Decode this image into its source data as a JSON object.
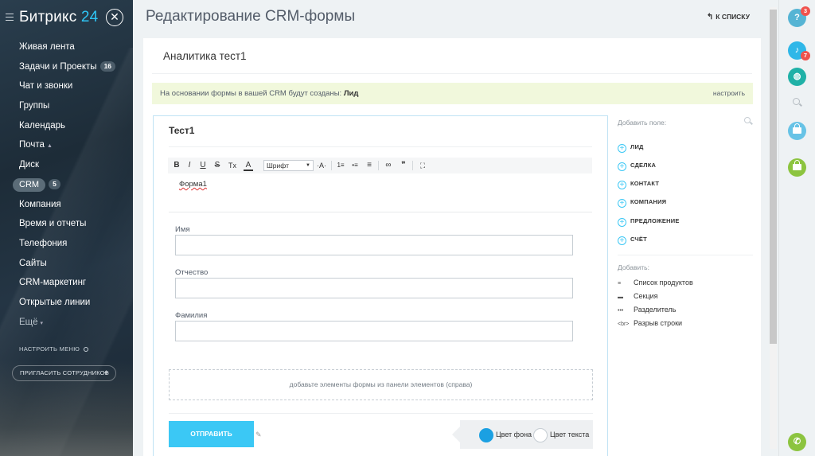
{
  "sidebar": {
    "logo_text": "Битрикс",
    "logo_num": "24",
    "close_glyph": "✕",
    "items": [
      {
        "label": "Живая лента"
      },
      {
        "label": "Задачи и Проекты",
        "badge": "16"
      },
      {
        "label": "Чат и звонки"
      },
      {
        "label": "Группы"
      },
      {
        "label": "Календарь"
      },
      {
        "label": "Почта",
        "arrow": "▲"
      },
      {
        "label": "Диск"
      },
      {
        "label": "CRM",
        "badge": "5"
      },
      {
        "label": "Компания"
      },
      {
        "label": "Время и отчеты"
      },
      {
        "label": "Телефония"
      },
      {
        "label": "Сайты"
      },
      {
        "label": "CRM-маркетинг"
      },
      {
        "label": "Открытые линии"
      },
      {
        "label": "Ещё",
        "arrow": "▾"
      }
    ],
    "settings_menu": "Настроить меню",
    "invite": "Пригласить сотрудников",
    "invite_plus": "+"
  },
  "header": {
    "title": "Редактирование CRM-формы",
    "back_label": "к списку",
    "back_icon": "↰"
  },
  "card": {
    "form_name": "Аналитика тест1",
    "notice_text": "На основании формы в вашей CRM будут созданы: ",
    "notice_entity": "Лид",
    "notice_action": "настроить"
  },
  "editor": {
    "title": "Тест1",
    "toolbar": {
      "bold": "B",
      "italic": "I",
      "underline": "U",
      "strike": "S",
      "clear": "Tx",
      "color": "A",
      "font_select": "Шрифт",
      "font_size": "·A·",
      "ol": "1≡",
      "ul": "•≡",
      "align": "≡",
      "link": "∞",
      "quote": "❞",
      "fullscreen": "⛶"
    },
    "content": "Форма1",
    "fields": [
      {
        "label": "Имя",
        "value": ""
      },
      {
        "label": "Отчество",
        "value": ""
      },
      {
        "label": "Фамилия",
        "value": ""
      }
    ],
    "drop_zone": "добавьте элементы формы из панели элементов (справа)",
    "submit": "Отправить",
    "bg_color_label": "Цвет фона",
    "text_color_label": "Цвет текста",
    "bg_color": "#1ba0e2"
  },
  "right_panel": {
    "add_field_placeholder": "Добавить поле:",
    "entities": [
      "Лид",
      "Сделка",
      "Контакт",
      "Компания",
      "Предложение",
      "Счёт"
    ],
    "add_label": "Добавить:",
    "add_items": [
      {
        "icon": "≡",
        "label": "Список продуктов"
      },
      {
        "icon": "▬",
        "label": "Секция"
      },
      {
        "icon": "•••",
        "label": "Разделитель"
      },
      {
        "icon": "<br>",
        "label": "Разрыв строки"
      }
    ]
  },
  "rail": {
    "help_badge": "3",
    "notif_badge": "7",
    "help_glyph": "?"
  },
  "colors": {
    "accent": "#3bc8f5",
    "notice_bg": "#f1f8dc",
    "phone_green": "#9dcf00"
  }
}
